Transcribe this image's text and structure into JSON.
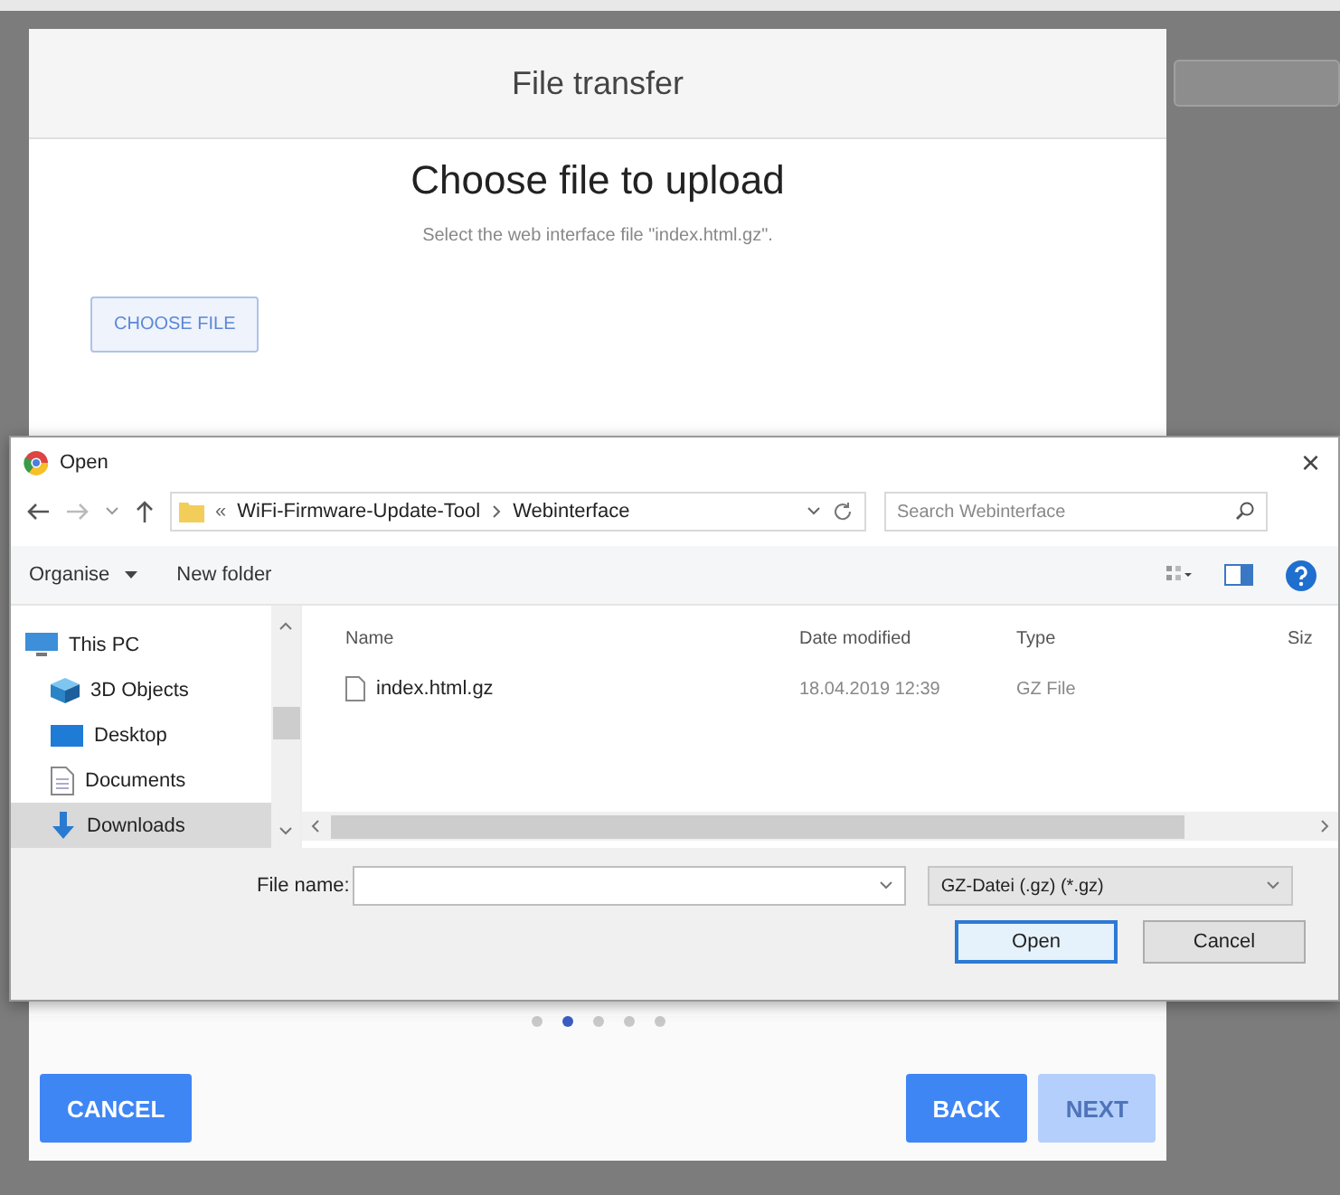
{
  "modal": {
    "title": "File transfer",
    "heading": "Choose file to upload",
    "description": "Select the web interface file \"index.html.gz\".",
    "choose_button": "CHOOSE FILE",
    "steps": [
      {
        "selected": false
      },
      {
        "selected": true
      },
      {
        "selected": false
      },
      {
        "selected": false
      },
      {
        "selected": false
      }
    ],
    "buttons": [
      {
        "label": "CANCEL",
        "disabled": false
      },
      {
        "label": "BACK",
        "disabled": false
      },
      {
        "label": "NEXT",
        "disabled": true
      }
    ]
  },
  "dialog": {
    "title": "Open",
    "close": "×",
    "path_prefix": "«",
    "path": [
      "WiFi-Firmware-Update-Tool",
      "Webinterface"
    ],
    "search": {
      "placeholder": "Search Webinterface"
    },
    "toolbar": {
      "organise": "Organise",
      "new_folder": "New folder"
    },
    "nav_items": [
      {
        "kind": "pc",
        "label": "This PC",
        "selected": false
      },
      {
        "kind": "cube",
        "label": "3D Objects",
        "selected": false
      },
      {
        "kind": "desktop",
        "label": "Desktop",
        "selected": false
      },
      {
        "kind": "document",
        "label": "Documents",
        "selected": false
      },
      {
        "kind": "download",
        "label": "Downloads",
        "selected": true
      }
    ],
    "columns": [
      "Name",
      "Date modified",
      "Type",
      "Siz"
    ],
    "files": [
      {
        "name": "index.html.gz",
        "date": "18.04.2019 12:39",
        "type": "GZ File"
      }
    ],
    "file_name_label": "File name:",
    "filter": "GZ-Datei (.gz) (*.gz)",
    "buttons": [
      "Open",
      "Cancel"
    ]
  }
}
